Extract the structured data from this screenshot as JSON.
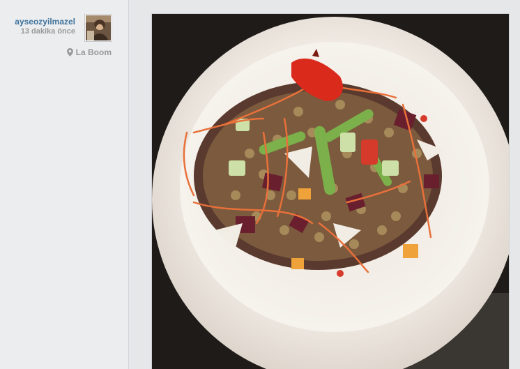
{
  "post": {
    "username": "ayseozyilmazel",
    "time_ago": "13 dakika önce",
    "location": "La Boom",
    "photo_subject": "lentil salad with beetroot, asparagus and carrot on a white plate"
  },
  "icons": {
    "avatar": "user-avatar",
    "location": "map-pin-icon"
  },
  "colors": {
    "username": "#3f729b",
    "muted_text": "#999999",
    "sidebar_bg": "#ebedef",
    "main_bg": "#e6e7e9"
  }
}
